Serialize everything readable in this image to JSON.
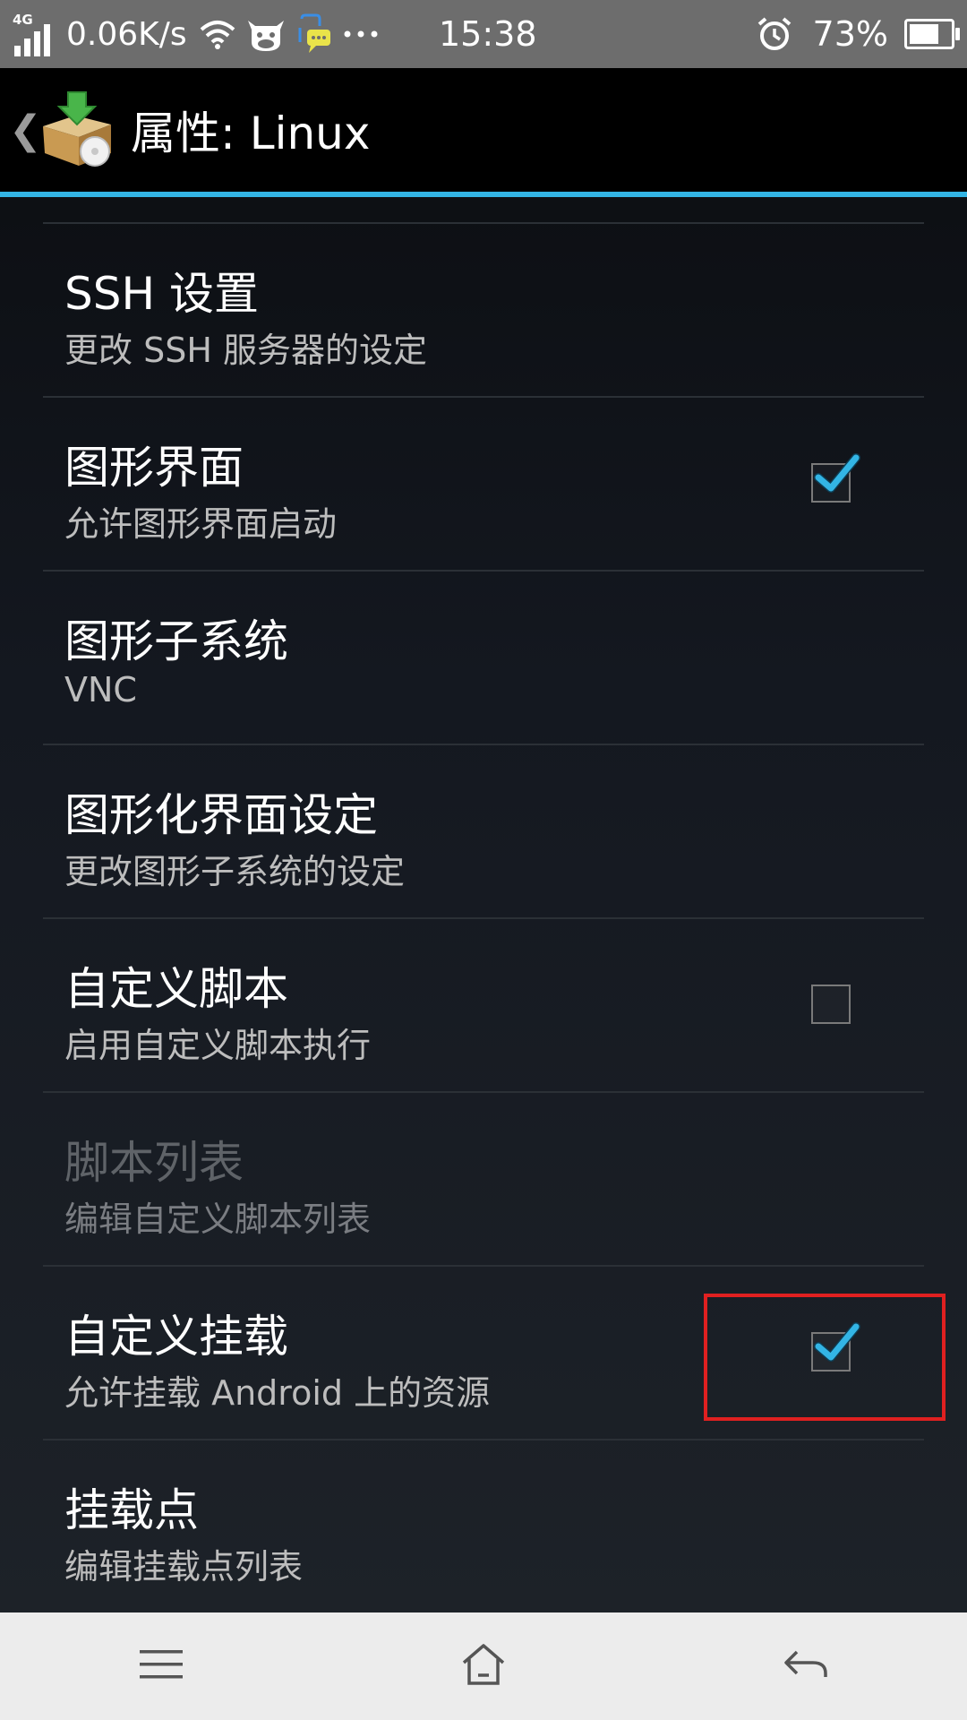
{
  "status_bar": {
    "network_type": "4G",
    "net_speed": "0.06K/s",
    "time": "15:38",
    "battery_percent": "73%",
    "battery_level": 0.73,
    "icons": [
      "signal-icon",
      "wifi-icon",
      "cow-app-icon",
      "chat-bot-icon",
      "more-dots-icon",
      "alarm-icon",
      "battery-icon"
    ]
  },
  "action_bar": {
    "title": "属性: Linux",
    "back_glyph": "❮",
    "app_icon": "package-install-icon"
  },
  "preferences": [
    {
      "id": "ssh",
      "title": "SSH 设置",
      "summary": "更改 SSH 服务器的设定",
      "checkbox": null,
      "enabled": true
    },
    {
      "id": "gui",
      "title": "图形界面",
      "summary": "允许图形界面启动",
      "checkbox": true,
      "enabled": true
    },
    {
      "id": "gui-subsystem",
      "title": "图形子系统",
      "summary": "VNC",
      "checkbox": null,
      "enabled": true
    },
    {
      "id": "gui-settings",
      "title": "图形化界面设定",
      "summary": "更改图形子系统的设定",
      "checkbox": null,
      "enabled": true
    },
    {
      "id": "custom-script",
      "title": "自定义脚本",
      "summary": "启用自定义脚本执行",
      "checkbox": false,
      "enabled": true
    },
    {
      "id": "script-list",
      "title": "脚本列表",
      "summary": "编辑自定义脚本列表",
      "checkbox": null,
      "enabled": false
    },
    {
      "id": "custom-mount",
      "title": "自定义挂载",
      "summary": "允许挂载 Android 上的资源",
      "checkbox": true,
      "enabled": true
    },
    {
      "id": "mount-points",
      "title": "挂载点",
      "summary": "编辑挂载点列表",
      "checkbox": null,
      "enabled": true
    }
  ],
  "highlight": {
    "target": "custom-mount",
    "color": "#e02020"
  },
  "nav_bar": {
    "buttons": [
      "menu-icon",
      "home-icon",
      "back-icon"
    ]
  },
  "colors": {
    "accent": "#33b5e5",
    "status_bar": "#6d6d6d",
    "nav_bar": "#ececec"
  }
}
